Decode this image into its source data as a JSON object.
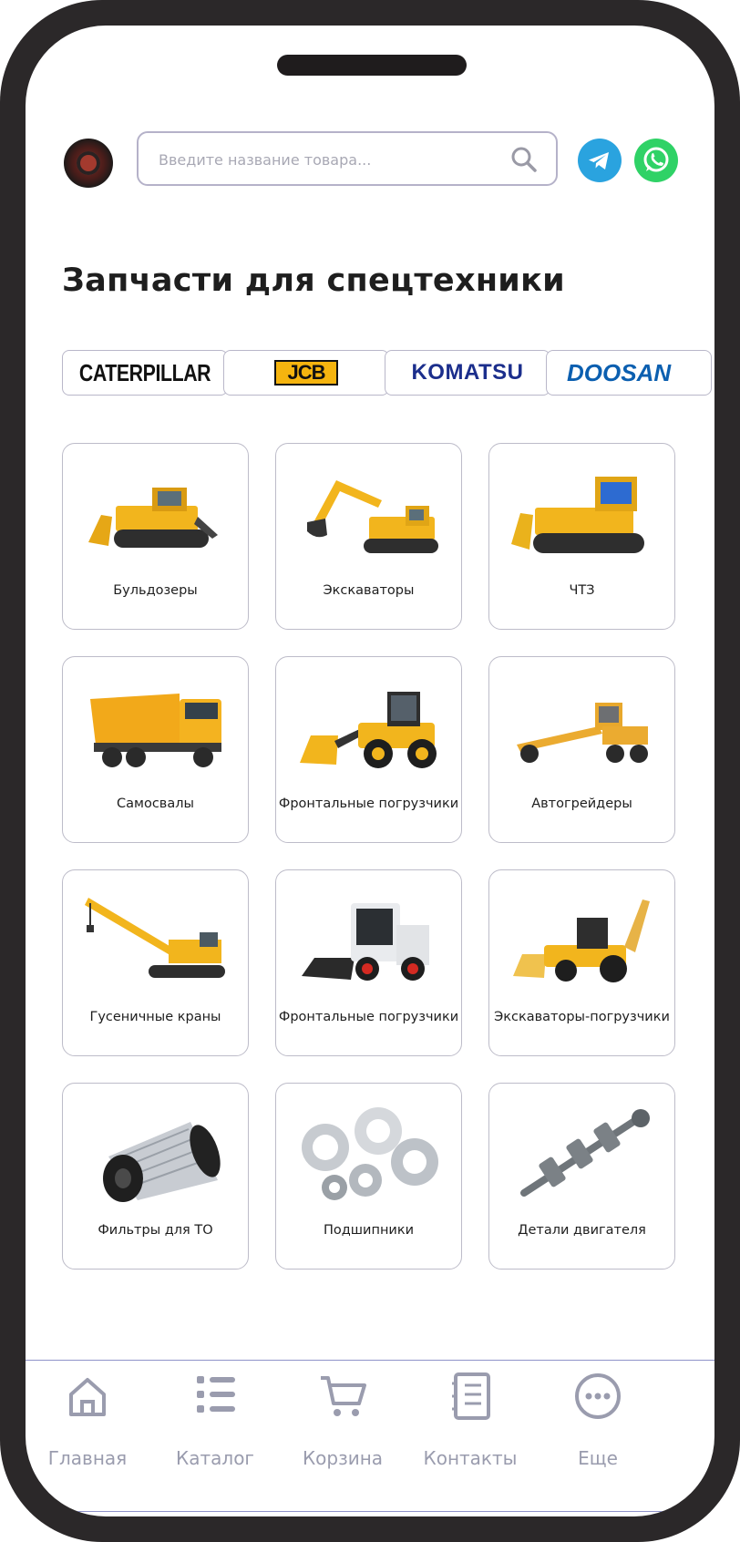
{
  "search": {
    "placeholder": "Введите название товара..."
  },
  "page_title": "Запчасти для спецтехники",
  "brands": [
    {
      "label": "CATERPILLAR"
    },
    {
      "label": "JCB"
    },
    {
      "label": "KOMATSU"
    },
    {
      "label": "DOOSAN"
    }
  ],
  "categories": [
    {
      "label": "Бульдозеры",
      "icon": "bulldozer"
    },
    {
      "label": "Экскаваторы",
      "icon": "excavator"
    },
    {
      "label": "ЧТЗ",
      "icon": "chtz-bulldozer"
    },
    {
      "label": "Самосвалы",
      "icon": "dump-truck"
    },
    {
      "label": "Фронтальные погрузчики",
      "icon": "wheel-loader"
    },
    {
      "label": "Автогрейдеры",
      "icon": "motor-grader"
    },
    {
      "label": "Гусеничные краны",
      "icon": "crawler-crane"
    },
    {
      "label": "Фронтальные погрузчики",
      "icon": "skid-steer-loader"
    },
    {
      "label": "Экскаваторы-погрузчики",
      "icon": "backhoe-loader"
    },
    {
      "label": "Фильтры для ТО",
      "icon": "filter"
    },
    {
      "label": "Подшипники",
      "icon": "bearings"
    },
    {
      "label": "Детали двигателя",
      "icon": "crankshaft"
    }
  ],
  "nav": [
    {
      "label": "Главная",
      "icon": "home-icon"
    },
    {
      "label": "Каталог",
      "icon": "list-icon"
    },
    {
      "label": "Корзина",
      "icon": "cart-icon"
    },
    {
      "label": "Контакты",
      "icon": "notebook-icon"
    },
    {
      "label": "Еще",
      "icon": "more-icon"
    }
  ],
  "colors": {
    "telegram": "#2aa3df",
    "whatsapp": "#2fd266",
    "machine_yellow": "#f2b51d",
    "nav_gray": "#9a9cae"
  }
}
